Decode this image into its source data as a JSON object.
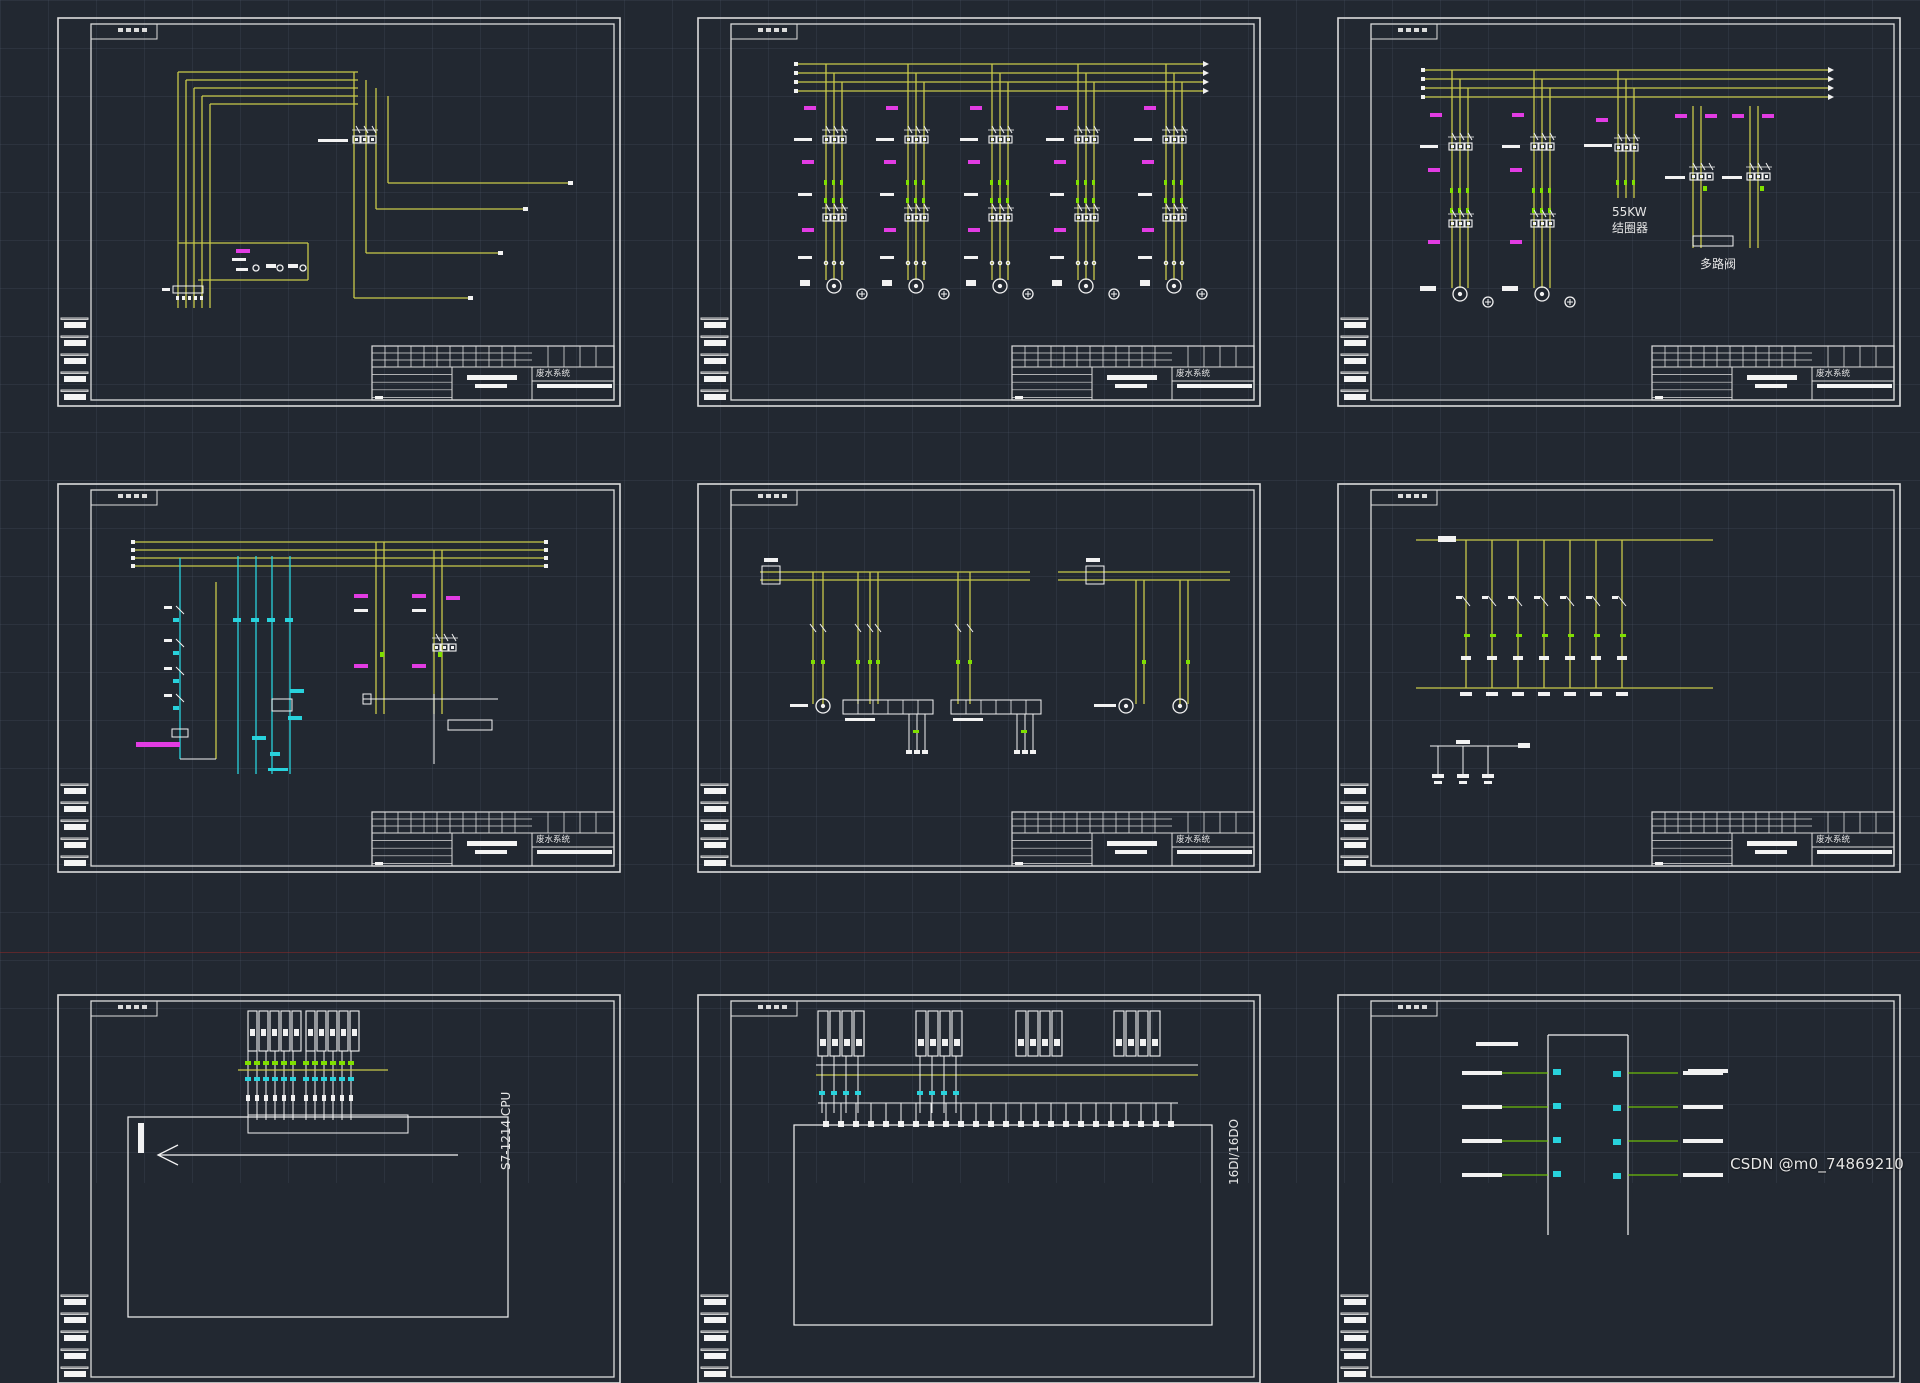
{
  "watermark": "CSDN @m0_74869210",
  "colors": {
    "background": "#222831",
    "frame": "#dcdcdc",
    "bus_yellow": "#c9c94a",
    "magenta": "#e23ce3",
    "green": "#7fe000",
    "cyan": "#28d2dc",
    "white": "#f2f2f2"
  },
  "sheets": [
    {
      "id": "sheet-1",
      "title_block_text": "废水系统"
    },
    {
      "id": "sheet-2",
      "title_block_text": "废水系统"
    },
    {
      "id": "sheet-3",
      "title_block_text": "废水系统",
      "motor_rating": "55KW",
      "motor_note": "结圈器",
      "device_label": "多路阀"
    },
    {
      "id": "sheet-4",
      "title_block_text": "废水系统"
    },
    {
      "id": "sheet-5",
      "title_block_text": "废水系统"
    },
    {
      "id": "sheet-6",
      "title_block_text": "废水系统"
    },
    {
      "id": "sheet-7",
      "plc_label": "S7-1214 CPU"
    },
    {
      "id": "sheet-8",
      "plc_label": "16DI/16DO"
    },
    {
      "id": "sheet-9"
    }
  ]
}
